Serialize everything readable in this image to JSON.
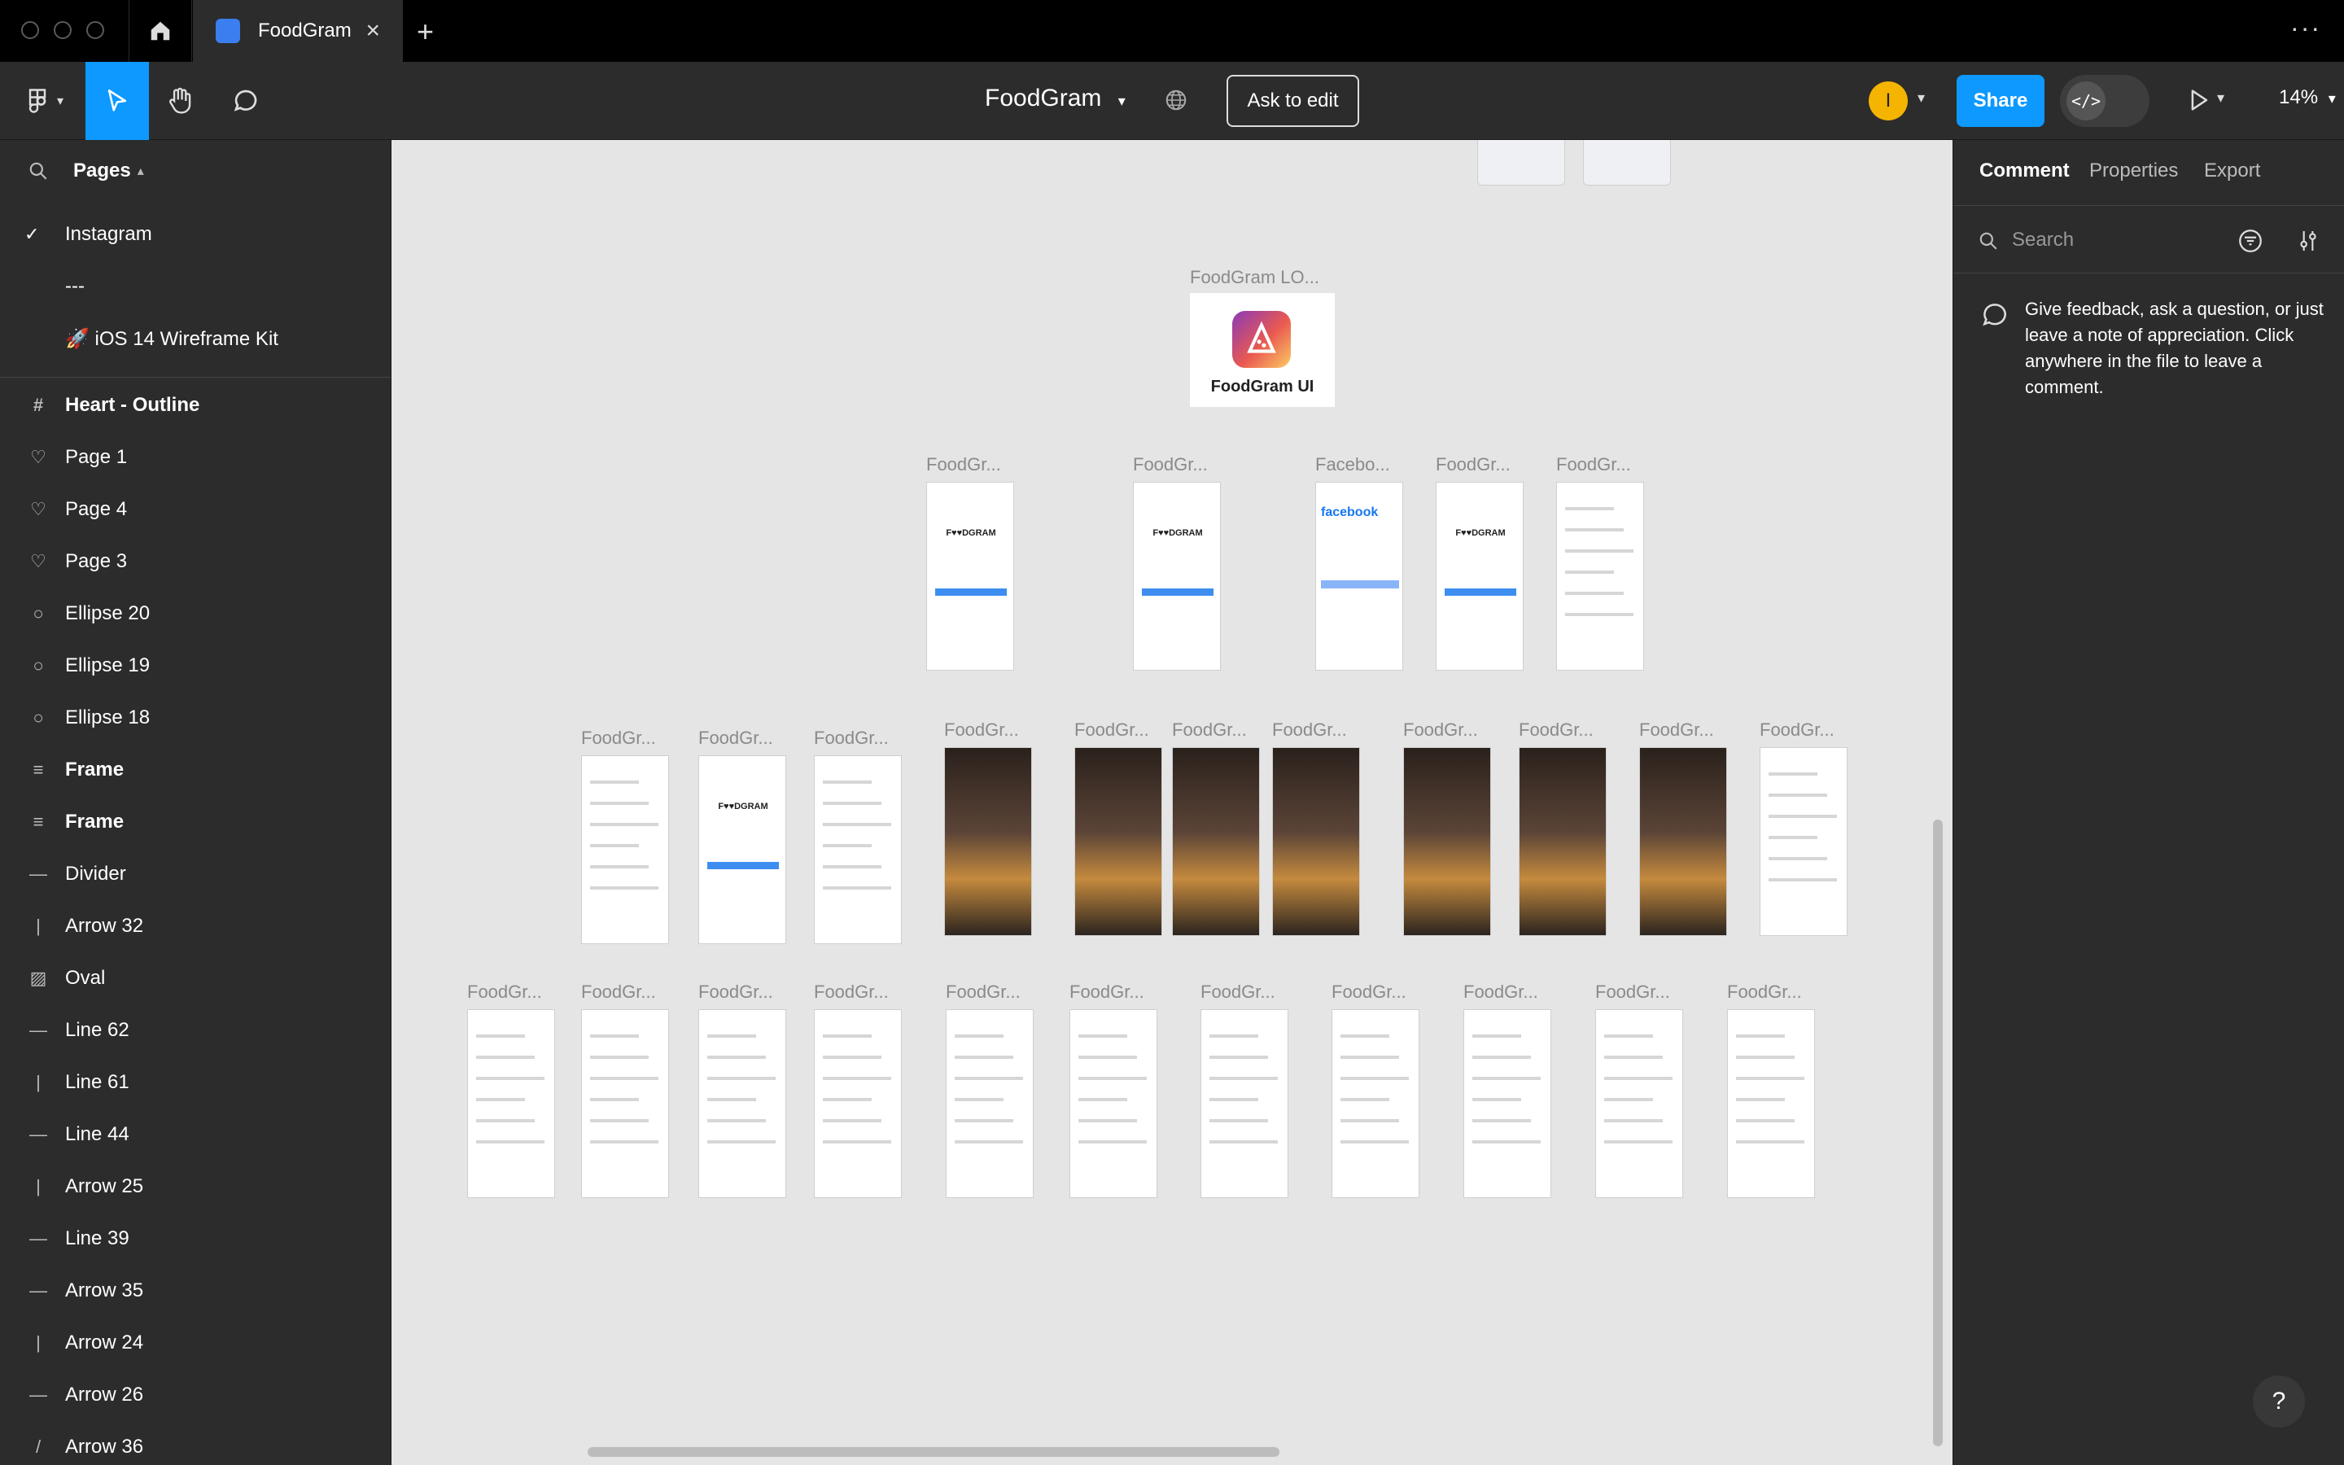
{
  "titlebar": {
    "tab_title": "FoodGram",
    "new_tab": "+",
    "more": "···"
  },
  "toolbar": {
    "doc_title": "FoodGram",
    "ask_to_edit": "Ask to edit",
    "avatar_letter": "I",
    "share": "Share",
    "dev_mode": "</>",
    "zoom": "14%"
  },
  "pages": {
    "header": "Pages",
    "items": [
      {
        "label": "Instagram",
        "selected": true
      },
      {
        "label": "---",
        "selected": false
      },
      {
        "label": "🚀 iOS 14 Wireframe Kit",
        "selected": false
      }
    ]
  },
  "layers": [
    {
      "icon": "frame-icon",
      "glyph": "#",
      "label": "Heart - Outline",
      "bold": true
    },
    {
      "icon": "heart-icon",
      "glyph": "♡",
      "label": "Page 1"
    },
    {
      "icon": "heart-icon",
      "glyph": "♡",
      "label": "Page 4"
    },
    {
      "icon": "heart-icon",
      "glyph": "♡",
      "label": "Page 3"
    },
    {
      "icon": "ellipse-icon",
      "glyph": "○",
      "label": "Ellipse 20"
    },
    {
      "icon": "ellipse-icon",
      "glyph": "○",
      "label": "Ellipse 19"
    },
    {
      "icon": "ellipse-icon",
      "glyph": "○",
      "label": "Ellipse 18"
    },
    {
      "icon": "auto-layout-icon",
      "glyph": "≡",
      "label": "Frame",
      "bold": true
    },
    {
      "icon": "auto-layout-icon",
      "glyph": "≡",
      "label": "Frame",
      "bold": true
    },
    {
      "icon": "line-icon",
      "glyph": "—",
      "label": "Divider"
    },
    {
      "icon": "arrow-icon",
      "glyph": "|",
      "label": "Arrow 32"
    },
    {
      "icon": "image-icon",
      "glyph": "▨",
      "label": "Oval"
    },
    {
      "icon": "line-icon",
      "glyph": "—",
      "label": "Line 62"
    },
    {
      "icon": "line-icon",
      "glyph": "|",
      "label": "Line 61"
    },
    {
      "icon": "line-icon",
      "glyph": "—",
      "label": "Line 44"
    },
    {
      "icon": "arrow-icon",
      "glyph": "|",
      "label": "Arrow 25"
    },
    {
      "icon": "line-icon",
      "glyph": "—",
      "label": "Line 39"
    },
    {
      "icon": "arrow-icon",
      "glyph": "—",
      "label": "Arrow 35"
    },
    {
      "icon": "arrow-icon",
      "glyph": "|",
      "label": "Arrow 24"
    },
    {
      "icon": "arrow-icon",
      "glyph": "—",
      "label": "Arrow 26"
    },
    {
      "icon": "arrow-icon",
      "glyph": "/",
      "label": "Arrow 36"
    }
  ],
  "canvas": {
    "logo_frame_label": "FoodGram LO...",
    "logo_text": "FoodGram UI",
    "frame_labels": {
      "foodgram": "FoodGr...",
      "facebook": "Facebo..."
    },
    "facebook_logo_text": "facebook",
    "foodgram_wordmark": "F♥♥DGRAM"
  },
  "right": {
    "tabs": [
      "Comment",
      "Properties",
      "Export"
    ],
    "search_placeholder": "Search",
    "hint": "Give feedback, ask a question, or just leave a note of appreciation. Click anywhere in the file to leave a comment."
  },
  "help": "?"
}
